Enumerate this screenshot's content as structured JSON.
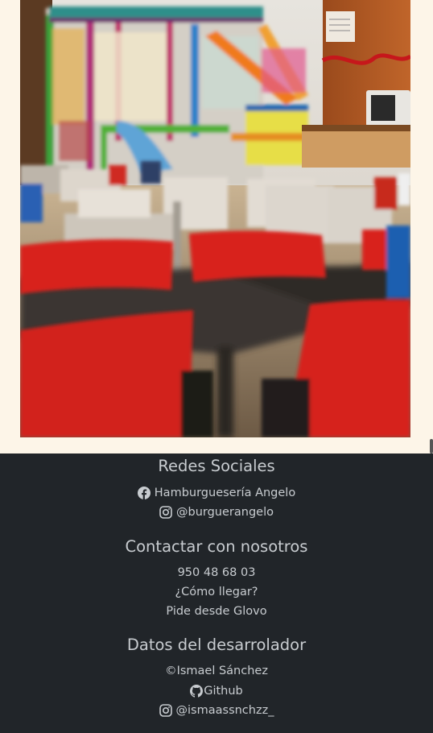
{
  "photo": {
    "alt": "Interior del restaurante con zona de juegos infantil"
  },
  "social": {
    "title": "Redes Sociales",
    "facebook": "Hamburguesería Angelo",
    "instagram": "@burguerangelo"
  },
  "contact": {
    "title": "Contactar con nosotros",
    "phone": "950 48 68 03",
    "directions": "¿Cómo llegar?",
    "glovo": "Pide desde Glovo"
  },
  "developer": {
    "title": "Datos del desarrolador",
    "copyright": "©Ismael Sánchez",
    "github": "Github",
    "instagram": "@ismaassnchzz_"
  },
  "colors": {
    "footer_bg": "#212529",
    "page_bg": "#fdf5e8",
    "chair_red": "#d8231f"
  }
}
